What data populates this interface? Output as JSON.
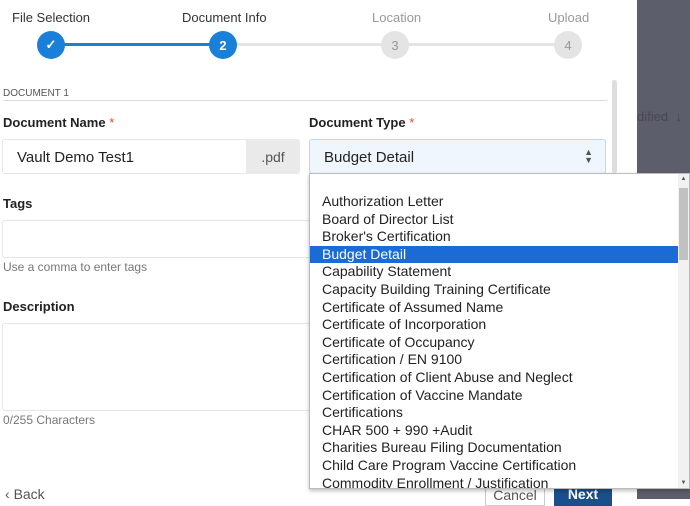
{
  "stepper": {
    "steps": [
      {
        "label": "File Selection",
        "state": "complete"
      },
      {
        "label": "Document Info",
        "number": "2",
        "state": "active"
      },
      {
        "label": "Location",
        "number": "3",
        "state": "todo"
      },
      {
        "label": "Upload",
        "number": "4",
        "state": "todo"
      }
    ]
  },
  "section_title": "DOCUMENT 1",
  "doc_name": {
    "label": "Document Name",
    "required": "*",
    "value": "Vault Demo Test1",
    "extension": ".pdf"
  },
  "doc_type": {
    "label": "Document Type",
    "required": "*",
    "value": "Budget Detail"
  },
  "tags": {
    "label": "Tags",
    "hint": "Use a comma to enter tags"
  },
  "description": {
    "label": "Description",
    "counter": "0/255 Characters"
  },
  "dropdown_options": [
    "Authorization Letter",
    "Board of Director List",
    "Broker's Certification",
    "Budget Detail",
    "Capability Statement",
    "Capacity Building Training Certificate",
    "Certificate of Assumed Name",
    "Certificate of Incorporation",
    "Certificate of Occupancy",
    "Certification / EN 9100",
    "Certification of Client Abuse and Neglect",
    "Certification of Vaccine Mandate",
    "Certifications",
    "CHAR 500 + 990 +Audit",
    "Charities Bureau Filing Documentation",
    "Child Care Program Vaccine Certification",
    "Commodity Enrollment / Justification"
  ],
  "selected_index": 3,
  "footer": {
    "back": "Back",
    "cancel": "Cancel",
    "next": "Next"
  },
  "background": {
    "column_header": "dified",
    "sort_icon": "↓"
  },
  "colors": {
    "accent": "#1a7fd9",
    "highlight": "#1a6bd6",
    "next": "#1a4f8b",
    "overlay": "#5d5e6b"
  }
}
